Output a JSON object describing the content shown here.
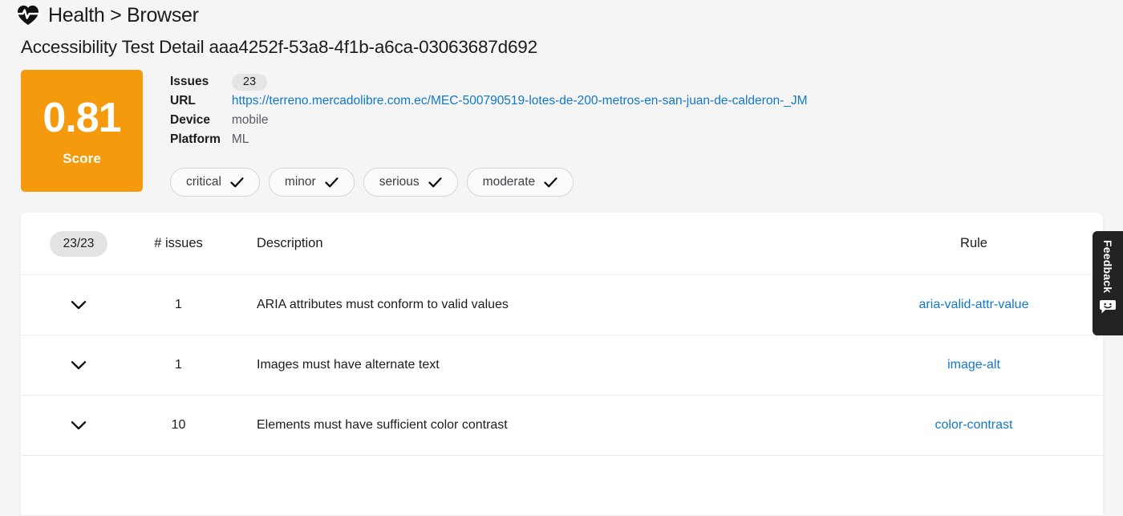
{
  "breadcrumb": {
    "icon": "heart-pulse-icon",
    "text": "Health > Browser"
  },
  "page_title": "Accessibility Test Detail aaa4252f-53a8-4f1b-a6ca-03063687d692",
  "score": {
    "value": "0.81",
    "label": "Score",
    "color": "#f49a0c"
  },
  "meta": {
    "rows": [
      {
        "key": "Issues",
        "value": "23",
        "type": "badge"
      },
      {
        "key": "URL",
        "value": "https://terreno.mercadolibre.com.ec/MEC-500790519-lotes-de-200-metros-en-san-juan-de-calderon-_JM",
        "type": "link"
      },
      {
        "key": "Device",
        "value": "mobile",
        "type": "text"
      },
      {
        "key": "Platform",
        "value": "ML",
        "type": "text"
      }
    ]
  },
  "chips": [
    {
      "label": "critical",
      "checked": true,
      "icon": "check-icon"
    },
    {
      "label": "minor",
      "checked": true,
      "icon": "check-icon"
    },
    {
      "label": "serious",
      "checked": true,
      "icon": "check-icon"
    },
    {
      "label": "moderate",
      "checked": true,
      "icon": "check-icon"
    }
  ],
  "table": {
    "header": {
      "count_badge": "23/23",
      "issues": "# issues",
      "description": "Description",
      "rule": "Rule"
    },
    "rows": [
      {
        "toggle": "chevron-down-icon",
        "count": "1",
        "description": "ARIA attributes must conform to valid values",
        "rule": "aria-valid-attr-value"
      },
      {
        "toggle": "chevron-down-icon",
        "count": "1",
        "description": "Images must have alternate text",
        "rule": "image-alt"
      },
      {
        "toggle": "chevron-down-icon",
        "count": "10",
        "description": "Elements must have sufficient color contrast",
        "rule": "color-contrast"
      }
    ]
  },
  "feedback": {
    "label": "Feedback",
    "icon": "smiley-bubble-icon"
  },
  "colors": {
    "accent_orange": "#f49a0c",
    "link_blue": "#1278c8",
    "page_background": "#f5f5f5",
    "card_background": "#ffffff",
    "feedback_background": "#232323"
  }
}
